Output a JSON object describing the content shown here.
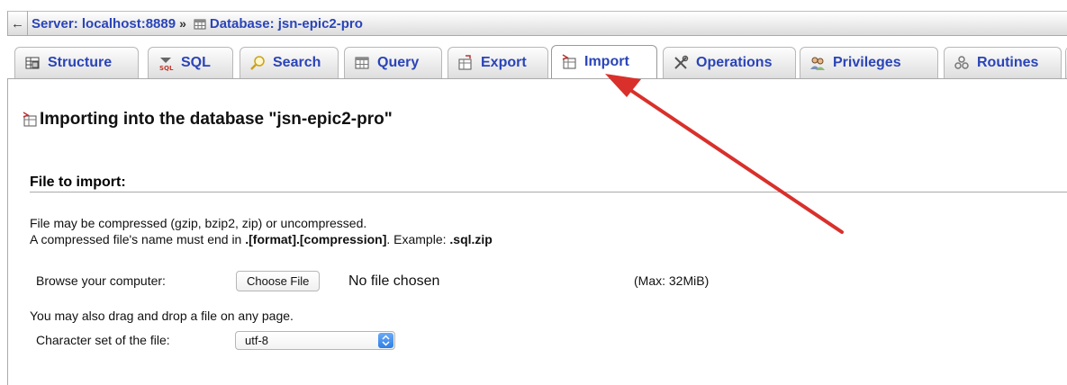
{
  "breadcrumb": {
    "back": "←",
    "server": "Server: localhost:8889",
    "separator": "»",
    "database": "Database: jsn-epic2-pro"
  },
  "tabs": [
    {
      "label": "Structure",
      "icon": "structure-icon"
    },
    {
      "label": "SQL",
      "icon": "sql-icon"
    },
    {
      "label": "Search",
      "icon": "search-icon"
    },
    {
      "label": "Query",
      "icon": "query-icon"
    },
    {
      "label": "Export",
      "icon": "export-icon"
    },
    {
      "label": "Import",
      "icon": "import-icon",
      "active": true
    },
    {
      "label": "Operations",
      "icon": "operations-icon"
    },
    {
      "label": "Privileges",
      "icon": "privileges-icon"
    },
    {
      "label": "Routines",
      "icon": "routines-icon"
    }
  ],
  "page": {
    "title": "Importing into the database \"jsn-epic2-pro\"",
    "section_title": "File to import:",
    "note_line1": "File may be compressed (gzip, bzip2, zip) or uncompressed.",
    "note_line2_prefix": "A compressed file's name must end in ",
    "note_line2_format": ".[format].[compression]",
    "note_line2_mid": ". Example: ",
    "note_line2_example": ".sql.zip",
    "browse_label": "Browse your computer:",
    "choose_file": "Choose File",
    "no_file": "No file chosen",
    "max_size": "(Max: 32MiB)",
    "drag_note": "You may also drag and drop a file on any page.",
    "charset_label": "Character set of the file:",
    "charset_value": "utf-8"
  },
  "colors": {
    "link": "#2a44b8",
    "annotation_arrow": "#d9302b",
    "select_spinner": "#2e7fe8"
  }
}
